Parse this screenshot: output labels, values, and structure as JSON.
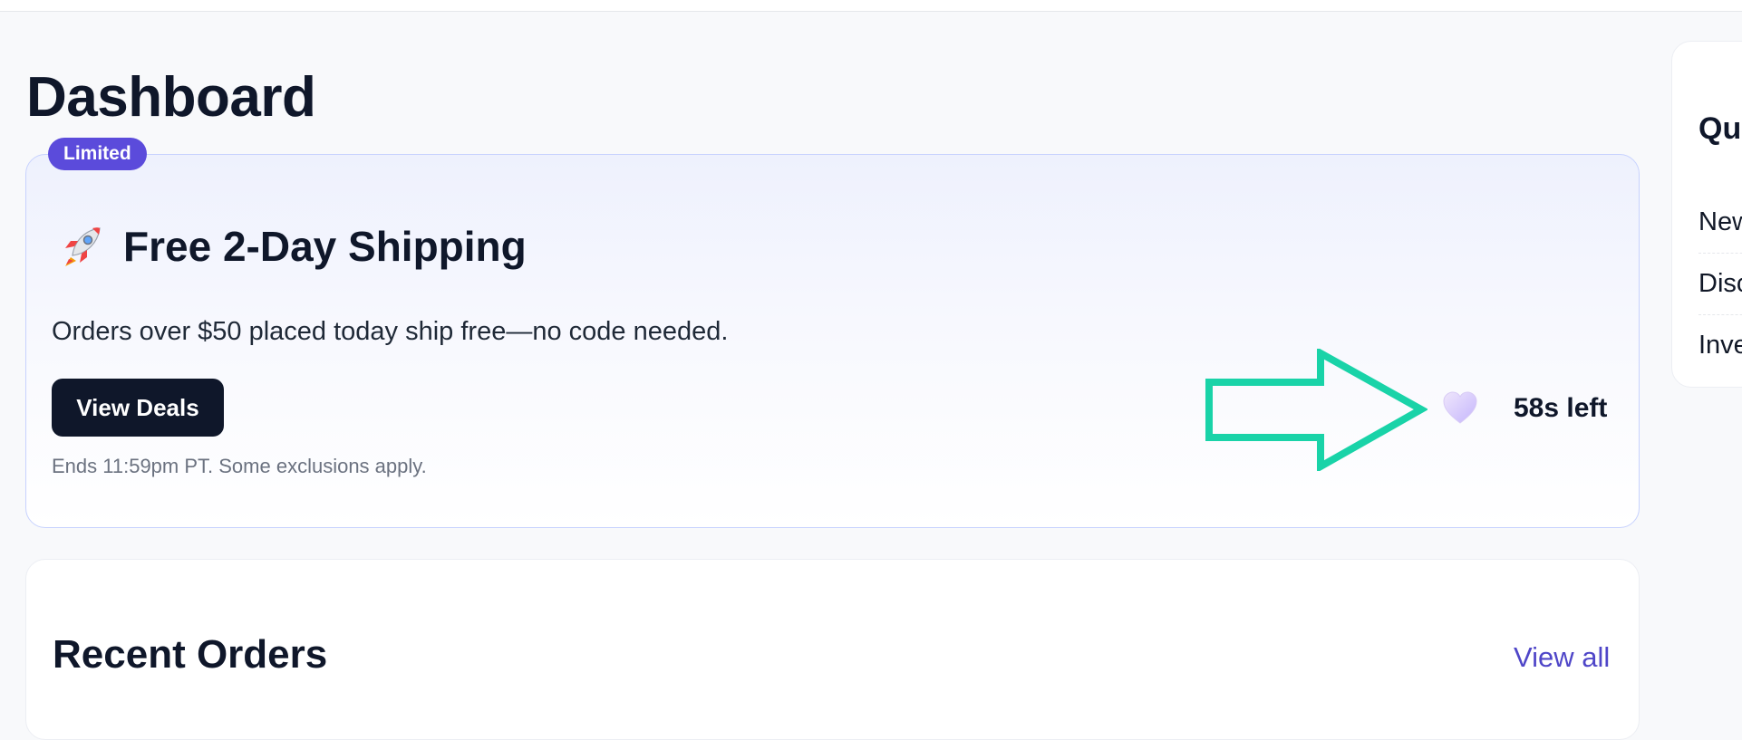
{
  "page": {
    "title": "Dashboard"
  },
  "promo": {
    "badge": "Limited",
    "icon": "rocket-icon",
    "title": "Free 2-Day Shipping",
    "description": "Orders over $50 placed today ship free—no code needed.",
    "cta_label": "View Deals",
    "fine_print": "Ends 11:59pm PT. Some exclusions apply.",
    "timer_icon": "heart-icon",
    "timer_text": "58s left"
  },
  "orders": {
    "title": "Recent Orders",
    "view_all_label": "View all"
  },
  "quick_panel": {
    "title_visible": "Qu",
    "items": [
      {
        "label": "New"
      },
      {
        "label": "Disc"
      },
      {
        "label": "Inve"
      }
    ]
  },
  "colors": {
    "badge": "#5b4bdb",
    "cta_background": "#0f172a",
    "link": "#4f46c8",
    "annotation_arrow": "#19d3a8",
    "card_border": "#c7d2fe"
  }
}
